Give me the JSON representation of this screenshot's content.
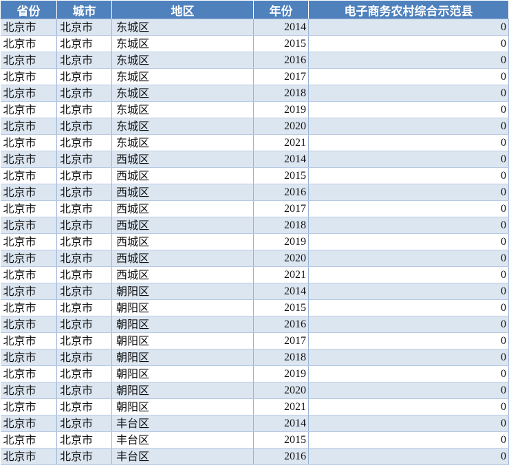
{
  "table": {
    "headers": [
      "省份",
      "城市",
      "地区",
      "年份",
      "电子商务农村综合示范县"
    ],
    "rows": [
      [
        "北京市",
        "北京市",
        "东城区",
        "2014",
        "0"
      ],
      [
        "北京市",
        "北京市",
        "东城区",
        "2015",
        "0"
      ],
      [
        "北京市",
        "北京市",
        "东城区",
        "2016",
        "0"
      ],
      [
        "北京市",
        "北京市",
        "东城区",
        "2017",
        "0"
      ],
      [
        "北京市",
        "北京市",
        "东城区",
        "2018",
        "0"
      ],
      [
        "北京市",
        "北京市",
        "东城区",
        "2019",
        "0"
      ],
      [
        "北京市",
        "北京市",
        "东城区",
        "2020",
        "0"
      ],
      [
        "北京市",
        "北京市",
        "东城区",
        "2021",
        "0"
      ],
      [
        "北京市",
        "北京市",
        "西城区",
        "2014",
        "0"
      ],
      [
        "北京市",
        "北京市",
        "西城区",
        "2015",
        "0"
      ],
      [
        "北京市",
        "北京市",
        "西城区",
        "2016",
        "0"
      ],
      [
        "北京市",
        "北京市",
        "西城区",
        "2017",
        "0"
      ],
      [
        "北京市",
        "北京市",
        "西城区",
        "2018",
        "0"
      ],
      [
        "北京市",
        "北京市",
        "西城区",
        "2019",
        "0"
      ],
      [
        "北京市",
        "北京市",
        "西城区",
        "2020",
        "0"
      ],
      [
        "北京市",
        "北京市",
        "西城区",
        "2021",
        "0"
      ],
      [
        "北京市",
        "北京市",
        "朝阳区",
        "2014",
        "0"
      ],
      [
        "北京市",
        "北京市",
        "朝阳区",
        "2015",
        "0"
      ],
      [
        "北京市",
        "北京市",
        "朝阳区",
        "2016",
        "0"
      ],
      [
        "北京市",
        "北京市",
        "朝阳区",
        "2017",
        "0"
      ],
      [
        "北京市",
        "北京市",
        "朝阳区",
        "2018",
        "0"
      ],
      [
        "北京市",
        "北京市",
        "朝阳区",
        "2019",
        "0"
      ],
      [
        "北京市",
        "北京市",
        "朝阳区",
        "2020",
        "0"
      ],
      [
        "北京市",
        "北京市",
        "朝阳区",
        "2021",
        "0"
      ],
      [
        "北京市",
        "北京市",
        "丰台区",
        "2014",
        "0"
      ],
      [
        "北京市",
        "北京市",
        "丰台区",
        "2015",
        "0"
      ],
      [
        "北京市",
        "北京市",
        "丰台区",
        "2016",
        "0"
      ]
    ]
  },
  "colors": {
    "header_bg": "#4f81bd",
    "header_text": "#ffffff",
    "band_odd": "#dce6f1",
    "band_even": "#ffffff"
  }
}
